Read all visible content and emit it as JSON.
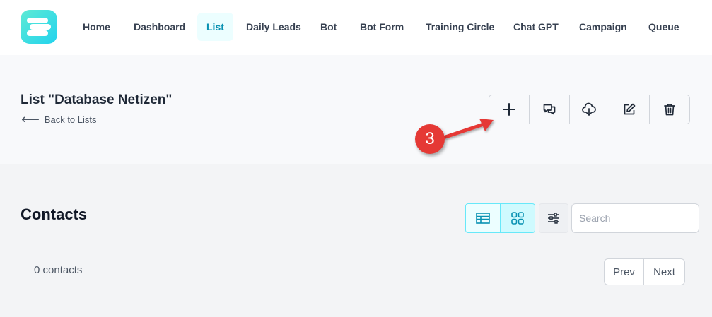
{
  "nav": {
    "items": [
      {
        "label": "Home"
      },
      {
        "label": "Dashboard"
      },
      {
        "label": "List"
      },
      {
        "label": "Daily Leads"
      },
      {
        "label": "Bot"
      },
      {
        "label": "Bot Form"
      },
      {
        "label": "Training Circle"
      },
      {
        "label": "Chat GPT"
      },
      {
        "label": "Campaign"
      },
      {
        "label": "Queue"
      }
    ],
    "active": "List"
  },
  "list_header": {
    "title": "List \"Database Netizen\"",
    "back_label": "Back to Lists",
    "actions": [
      "plus-icon",
      "chat-icon",
      "download-icon",
      "edit-icon",
      "trash-icon"
    ]
  },
  "annotation": {
    "step_number": "3",
    "color": "#e53935"
  },
  "contacts": {
    "title": "Contacts",
    "search_placeholder": "Search",
    "count_text": "0 contacts",
    "prev_label": "Prev",
    "next_label": "Next"
  },
  "colors": {
    "accent": "#0891b2",
    "accent_light": "#ecfeff",
    "logo": "#22d3ee"
  }
}
